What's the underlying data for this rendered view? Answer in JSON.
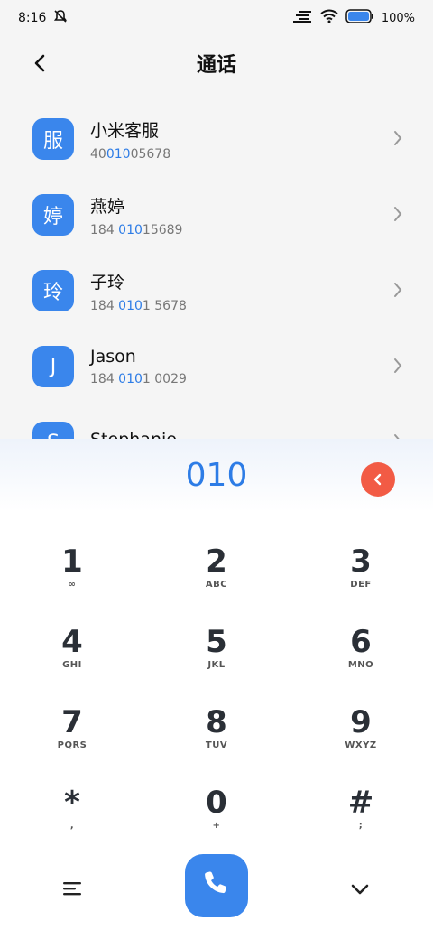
{
  "status": {
    "time": "8:16",
    "battery": "100%"
  },
  "header": {
    "title": "通话"
  },
  "contacts": [
    {
      "avatar": "服",
      "name": "小米客服",
      "num_pre": "40",
      "num_hl": "010",
      "num_post": "05678"
    },
    {
      "avatar": "婷",
      "name": "燕婷",
      "num_pre": "184 ",
      "num_hl": "010",
      "num_post": "15689"
    },
    {
      "avatar": "玲",
      "name": "子玲",
      "num_pre": "184 ",
      "num_hl": "010",
      "num_post": "1 5678"
    },
    {
      "avatar": "J",
      "name": "Jason",
      "num_pre": "184 ",
      "num_hl": "010",
      "num_post": "1 0029"
    },
    {
      "avatar": "S",
      "name": "Stephanie",
      "num_pre": "",
      "num_hl": "",
      "num_post": ""
    }
  ],
  "dialer": {
    "input": "010",
    "keys": [
      {
        "digit": "1",
        "letters": "∞"
      },
      {
        "digit": "2",
        "letters": "ABC"
      },
      {
        "digit": "3",
        "letters": "DEF"
      },
      {
        "digit": "4",
        "letters": "GHI"
      },
      {
        "digit": "5",
        "letters": "JKL"
      },
      {
        "digit": "6",
        "letters": "MNO"
      },
      {
        "digit": "7",
        "letters": "PQRS"
      },
      {
        "digit": "8",
        "letters": "TUV"
      },
      {
        "digit": "9",
        "letters": "WXYZ"
      },
      {
        "digit": "*",
        "letters": ","
      },
      {
        "digit": "0",
        "letters": "+"
      },
      {
        "digit": "#",
        "letters": ";"
      }
    ]
  },
  "colors": {
    "accent": "#3a86ec",
    "delete": "#f25b45",
    "highlight": "#2d7ce6"
  }
}
